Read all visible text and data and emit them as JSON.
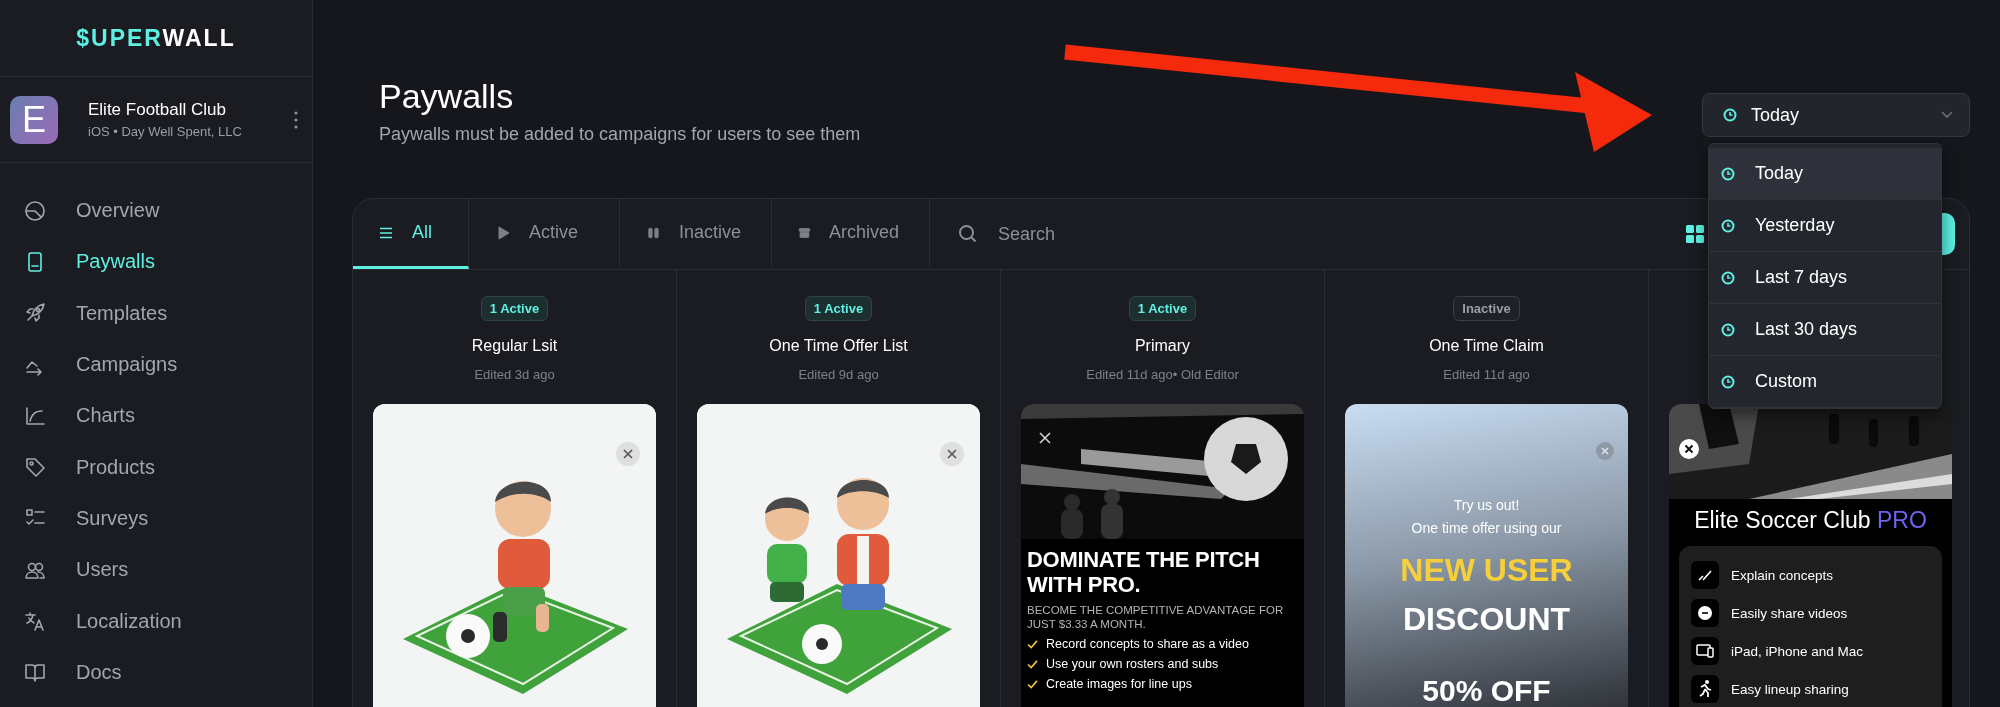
{
  "logo": {
    "accent": "$UPER",
    "rest": "WALL"
  },
  "organization": {
    "initial": "E",
    "name": "Elite Football Club",
    "subtitle": "iOS • Day Well Spent, LLC"
  },
  "sidebar": {
    "items": [
      {
        "label": "Overview",
        "selected": false
      },
      {
        "label": "Paywalls",
        "selected": true
      },
      {
        "label": "Templates",
        "selected": false
      },
      {
        "label": "Campaigns",
        "selected": false
      },
      {
        "label": "Charts",
        "selected": false
      },
      {
        "label": "Products",
        "selected": false
      },
      {
        "label": "Surveys",
        "selected": false
      },
      {
        "label": "Users",
        "selected": false
      },
      {
        "label": "Localization",
        "selected": false
      },
      {
        "label": "Docs",
        "selected": false
      }
    ]
  },
  "header": {
    "title": "Paywalls",
    "subtitle": "Paywalls must be added to campaigns for users to see them"
  },
  "date_range": {
    "value": "Today",
    "menu": [
      {
        "label": "Today",
        "selected": true
      },
      {
        "label": "Yesterday",
        "selected": false
      },
      {
        "label": "Last 7 days",
        "selected": false
      },
      {
        "label": "Last 30 days",
        "selected": false
      },
      {
        "label": "Custom",
        "selected": false
      }
    ]
  },
  "tabs": [
    {
      "label": "All",
      "selected": true
    },
    {
      "label": "Active",
      "selected": false
    },
    {
      "label": "Inactive",
      "selected": false
    },
    {
      "label": "Archived",
      "selected": false
    }
  ],
  "search": {
    "placeholder": "Search"
  },
  "paywalls": [
    {
      "active": true,
      "badge": "1 Active",
      "name": "Regular Lsit",
      "edited": "Edited 3d ago"
    },
    {
      "active": true,
      "badge": "1 Active",
      "name": "One Time Offer List",
      "edited": "Edited 9d ago"
    },
    {
      "active": true,
      "badge": "1 Active",
      "name": "Primary",
      "edited": "Edited 11d ago• Old Editor",
      "preview": {
        "kind": "promo",
        "heading": "DOMINATE THE PITCH WITH PRO.",
        "subheading": "BECOME THE COMPETITIVE ADVANTAGE FOR JUST $3.33 A MONTH.",
        "checklist": [
          "Record concepts to share as a video",
          "Use your own rosters and subs",
          "Create images for line ups"
        ]
      }
    },
    {
      "active": false,
      "badge": "Inactive",
      "name": "One Time Claim",
      "edited": "Edited 11d ago",
      "preview": {
        "kind": "offer",
        "intro": [
          "Try us out!",
          "One time offer using our"
        ],
        "highlight": "NEW USER",
        "headline": "DISCOUNT",
        "deal": "50% OFF"
      }
    },
    {
      "preview": {
        "kind": "features",
        "title": "Elite Soccer Club",
        "title_accent": "PRO",
        "features": [
          "Explain concepts",
          "Easily share videos",
          "iPad, iPhone and Mac",
          "Easy lineup sharing"
        ]
      }
    }
  ]
}
